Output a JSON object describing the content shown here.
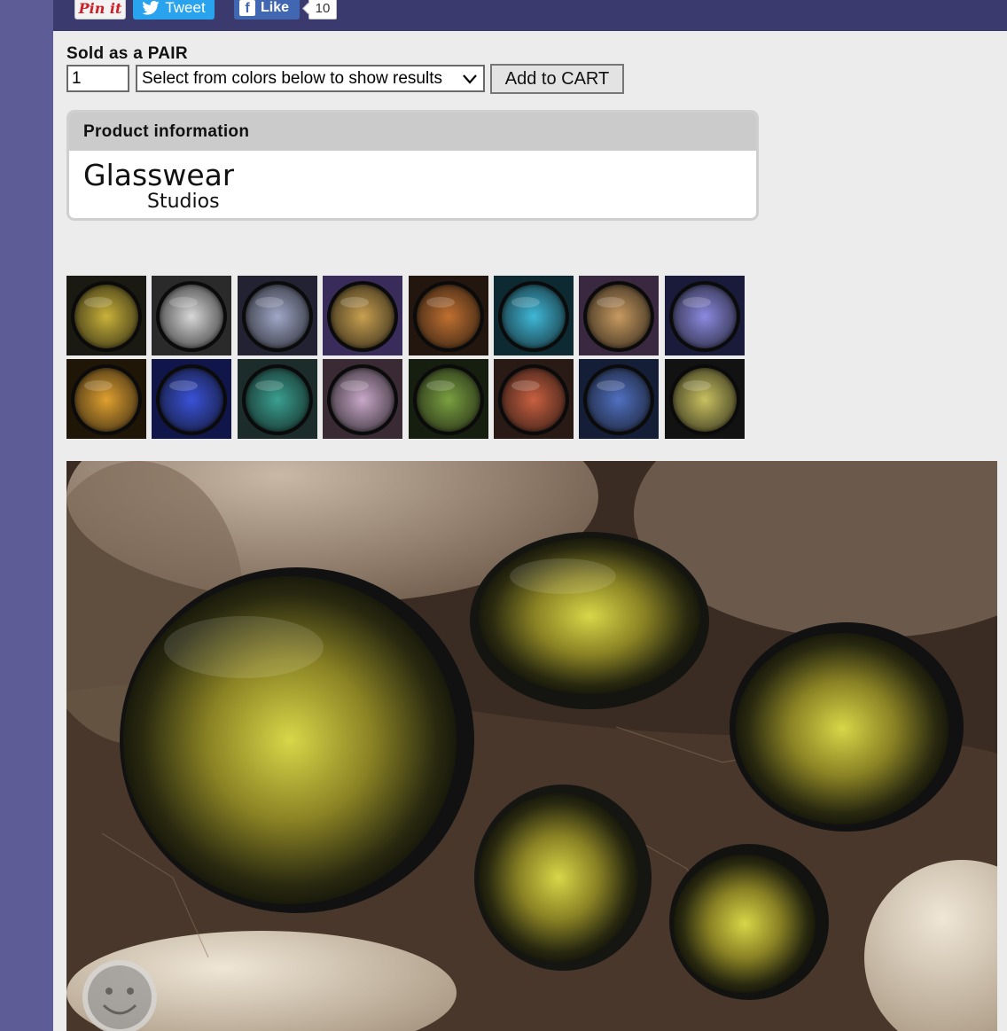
{
  "social": {
    "pin_label": "Pin it",
    "tweet_label": "Tweet",
    "like_label": "Like",
    "like_count": "10"
  },
  "product": {
    "sold_as": "Sold as a PAIR",
    "quantity": "1",
    "select_placeholder": "Select from colors below to show results",
    "add_to_cart": "Add to CART"
  },
  "info": {
    "heading": "Product information",
    "brand_line1": "Glasswear",
    "brand_line2": "Studios"
  },
  "thumbnails": [
    {
      "name": "thumb-gold-1",
      "color": "#c9b23a",
      "bg": "#1a1a12"
    },
    {
      "name": "thumb-silver",
      "color": "#d8d8d8",
      "bg": "#2a2a2a"
    },
    {
      "name": "thumb-starburst",
      "color": "#a0a8c8",
      "bg": "#222233"
    },
    {
      "name": "thumb-violet-gold",
      "color": "#c8a050",
      "bg": "#3a2c5a"
    },
    {
      "name": "thumb-copper",
      "color": "#c07030",
      "bg": "#22160e"
    },
    {
      "name": "thumb-cyan",
      "color": "#3fb8d8",
      "bg": "#0d2a33"
    },
    {
      "name": "thumb-purple-gold",
      "color": "#c89a60",
      "bg": "#3a2840"
    },
    {
      "name": "thumb-indigo",
      "color": "#8b8ae0",
      "bg": "#1a1a3a"
    },
    {
      "name": "thumb-gold-2",
      "color": "#e0a030",
      "bg": "#201608"
    },
    {
      "name": "thumb-blue",
      "color": "#3a52d8",
      "bg": "#10164a"
    },
    {
      "name": "thumb-teal",
      "color": "#3aa090",
      "bg": "#1c2c2a"
    },
    {
      "name": "thumb-lilac",
      "color": "#c8a8c8",
      "bg": "#3a2a33"
    },
    {
      "name": "thumb-green",
      "color": "#7aa040",
      "bg": "#161e10"
    },
    {
      "name": "thumb-rust",
      "color": "#c86040",
      "bg": "#2a1a16"
    },
    {
      "name": "thumb-navy",
      "color": "#5070c0",
      "bg": "#141e36"
    },
    {
      "name": "thumb-iridescent",
      "color": "#c8c060",
      "bg": "#121212"
    }
  ],
  "hero_image": {
    "name": "hero-plugs-gold",
    "color": "#b8b030"
  }
}
